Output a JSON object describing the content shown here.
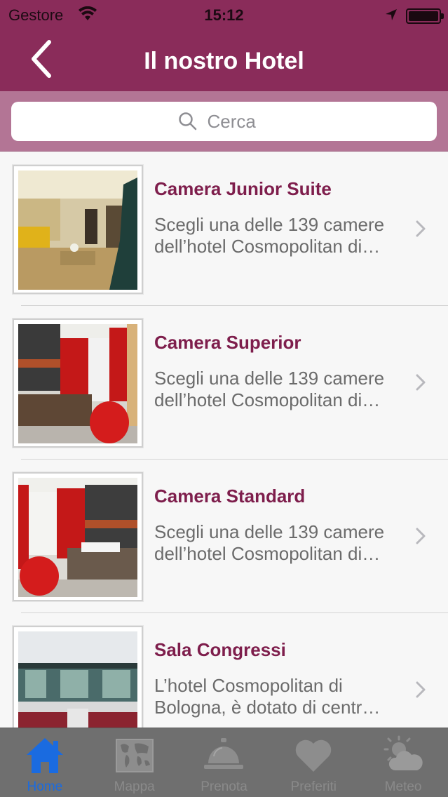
{
  "status_bar": {
    "carrier": "Gestore",
    "time": "15:12"
  },
  "nav": {
    "title": "Il nostro Hotel",
    "back_icon": "chevron-left-icon"
  },
  "search": {
    "placeholder": "Cerca",
    "value": ""
  },
  "items": [
    {
      "title": "Camera Junior Suite",
      "desc_line1": "Scegli una delle 139 camere",
      "desc_line2": "dell’hotel Cosmopolitan di…"
    },
    {
      "title": "Camera Superior",
      "desc_line1": "Scegli una delle 139 camere",
      "desc_line2": "dell’hotel Cosmopolitan di…"
    },
    {
      "title": "Camera Standard",
      "desc_line1": "Scegli una delle 139 camere",
      "desc_line2": "dell’hotel Cosmopolitan di…"
    },
    {
      "title": "Sala Congressi",
      "desc_line1": "L’hotel Cosmopolitan di",
      "desc_line2": "Bologna, è dotato di centr…"
    }
  ],
  "tabs": [
    {
      "label": "Home",
      "icon": "home-icon",
      "active": true
    },
    {
      "label": "Mappa",
      "icon": "world-map-icon",
      "active": false
    },
    {
      "label": "Prenota",
      "icon": "service-bell-icon",
      "active": false
    },
    {
      "label": "Preferiti",
      "icon": "heart-icon",
      "active": false
    },
    {
      "label": "Meteo",
      "icon": "weather-icon",
      "active": false
    }
  ],
  "colors": {
    "header": "#8a2c5a",
    "title_text": "#7e1e4c",
    "tab_active": "#1a6be0",
    "tab_bar": "#6f6f6f"
  }
}
